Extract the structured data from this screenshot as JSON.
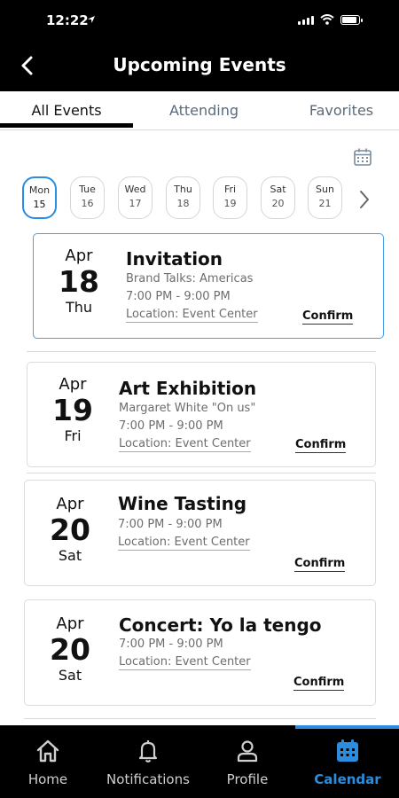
{
  "status": {
    "time": "12:22"
  },
  "header": {
    "title": "Upcoming Events"
  },
  "tabs": [
    {
      "label": "All Events",
      "active": true
    },
    {
      "label": "Attending",
      "active": false
    },
    {
      "label": "Favorites",
      "active": false
    }
  ],
  "days": [
    {
      "name": "Mon",
      "num": "15",
      "selected": true
    },
    {
      "name": "Tue",
      "num": "16"
    },
    {
      "name": "Wed",
      "num": "17"
    },
    {
      "name": "Thu",
      "num": "18"
    },
    {
      "name": "Fri",
      "num": "19"
    },
    {
      "name": "Sat",
      "num": "20"
    },
    {
      "name": "Sun",
      "num": "21"
    }
  ],
  "events": [
    {
      "month": "Apr",
      "day": "18",
      "dow": "Thu",
      "title": "Invitation",
      "subtitle": "Brand Talks: Americas",
      "time": "7:00 PM - 9:00 PM",
      "location": "Location: Event Center",
      "action": "Confirm"
    },
    {
      "month": "Apr",
      "day": "19",
      "dow": "Fri",
      "title": "Art Exhibition",
      "subtitle": "Margaret White \"On us\"",
      "time": "7:00 PM - 9:00 PM",
      "location": "Location: Event Center",
      "action": "Confirm"
    },
    {
      "month": "Apr",
      "day": "20",
      "dow": "Sat",
      "title": "Wine Tasting",
      "time": "7:00 PM - 9:00 PM",
      "location": "Location: Event Center",
      "action": "Confirm"
    },
    {
      "month": "Apr",
      "day": "20",
      "dow": "Sat",
      "title": "Concert: Yo la tengo",
      "time": "7:00 PM - 9:00 PM",
      "location": "Location: Event Center",
      "action": "Confirm"
    }
  ],
  "nav": [
    {
      "label": "Home",
      "icon": "home-icon"
    },
    {
      "label": "Notifications",
      "icon": "bell-icon"
    },
    {
      "label": "Profile",
      "icon": "person-icon"
    },
    {
      "label": "Calendar",
      "icon": "calendar-icon",
      "active": true
    }
  ],
  "colors": {
    "accent": "#2a8de0",
    "header_bg": "#000000"
  }
}
